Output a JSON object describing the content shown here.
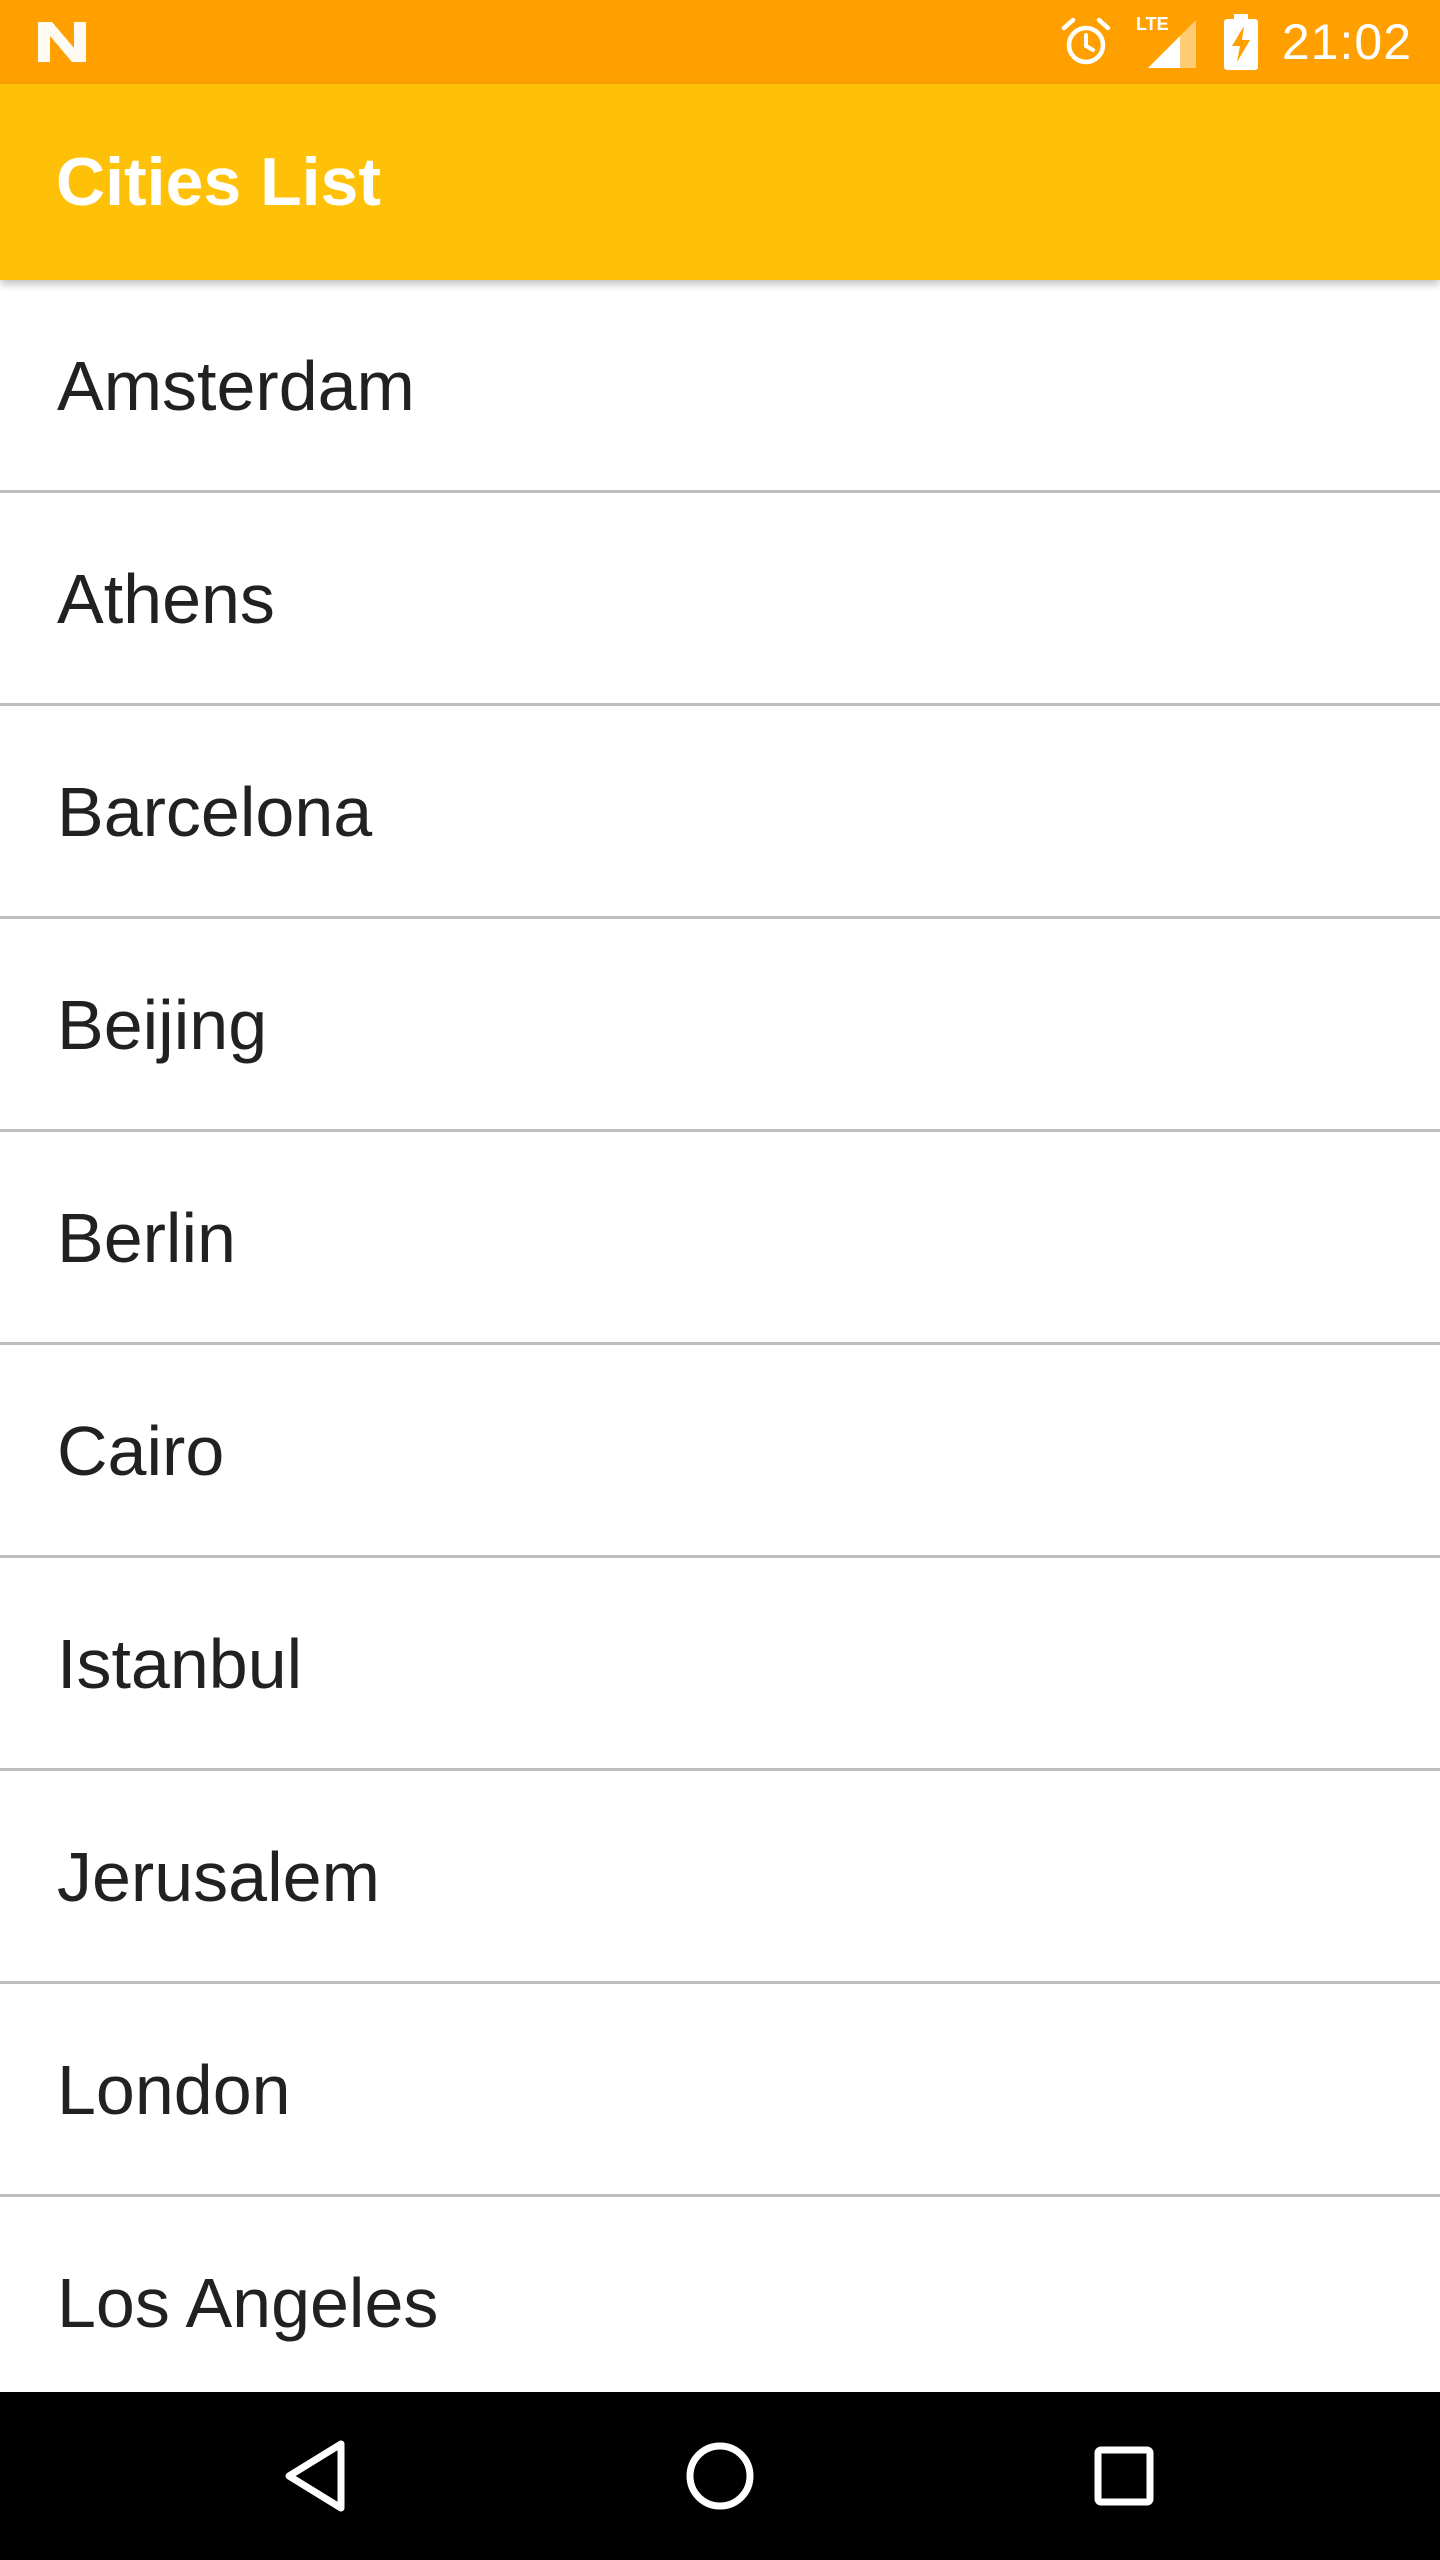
{
  "status_bar": {
    "time": "21:02",
    "network_type": "LTE",
    "icons": [
      "n-logo-icon",
      "alarm-icon",
      "lte-signal-icon",
      "battery-charging-icon"
    ]
  },
  "app_bar": {
    "title": "Cities List",
    "color": "#FFC107"
  },
  "cities": [
    {
      "name": "Amsterdam"
    },
    {
      "name": "Athens"
    },
    {
      "name": "Barcelona"
    },
    {
      "name": "Beijing"
    },
    {
      "name": "Berlin"
    },
    {
      "name": "Cairo"
    },
    {
      "name": "Istanbul"
    },
    {
      "name": "Jerusalem"
    },
    {
      "name": "London"
    },
    {
      "name": "Los Angeles"
    }
  ],
  "nav_bar": {
    "buttons": [
      "back-icon",
      "home-icon",
      "recents-icon"
    ]
  },
  "colors": {
    "status_bar": "#FFA000",
    "app_bar": "#FFC107",
    "divider": "#BDBDBD",
    "text": "#212121"
  }
}
